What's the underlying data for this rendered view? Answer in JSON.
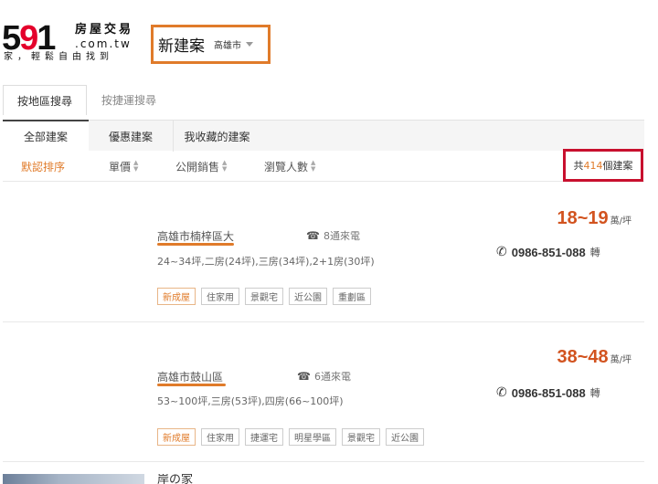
{
  "header": {
    "logo_digits_1": "5",
    "logo_digits_2": "9",
    "logo_digits_3": "1",
    "logo_cn": "房屋交易",
    "logo_domain": ".com.tw",
    "logo_slogan": "家，輕鬆自由找到",
    "section_title": "新建案",
    "city": "高雄市"
  },
  "mode_tabs": [
    {
      "label": "按地區搜尋",
      "active": true
    },
    {
      "label": "按捷運搜尋",
      "active": false
    }
  ],
  "category_tabs": [
    {
      "label": "全部建案",
      "active": true
    },
    {
      "label": "優惠建案",
      "active": false
    },
    {
      "label": "我收藏的建案",
      "active": false
    }
  ],
  "sort": [
    {
      "label": "默認排序",
      "active": true
    },
    {
      "label": "單價",
      "active": false
    },
    {
      "label": "公開銷售",
      "active": false
    },
    {
      "label": "瀏覽人數",
      "active": false
    }
  ],
  "count": {
    "prefix": "共",
    "value": "414",
    "suffix": "個建案"
  },
  "listings": [
    {
      "address": "高雄市楠梓區大",
      "calls": "8通來電",
      "desc": "24~34坪,二房(24坪),三房(34坪),2+1房(30坪)",
      "tags": [
        "新成屋",
        "住家用",
        "景觀宅",
        "近公園",
        "重劃區"
      ],
      "price": "18~19",
      "price_unit": "萬/坪",
      "phone": "0986-851-088",
      "ext": "轉"
    },
    {
      "address": "高雄市鼓山區",
      "calls": "6通來電",
      "desc": "53~100坪,三房(53坪),四房(66~100坪)",
      "tags": [
        "新成屋",
        "住家用",
        "捷運宅",
        "明星學區",
        "景觀宅",
        "近公園"
      ],
      "price": "38~48",
      "price_unit": "萬/坪",
      "phone": "0986-851-088",
      "ext": "轉"
    }
  ],
  "partial_listing": {
    "title": "岸の家"
  },
  "colors": {
    "accent": "#e07b2a",
    "price": "#d2531f",
    "highlight_box": "#c8102e"
  }
}
